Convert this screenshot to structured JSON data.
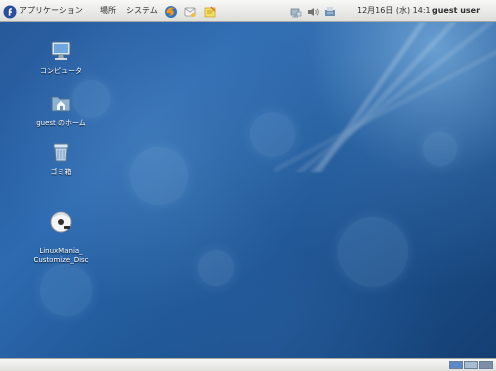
{
  "top_panel": {
    "applications_label": "アプリケーション",
    "places_label": "場所",
    "system_label": "システム",
    "clock": "12月16日 (水) 14:1",
    "user": "guest user",
    "menu_logo_icon": "fedora-logo-icon",
    "launcher_icons": [
      "firefox-icon",
      "evolution-icon",
      "notes-icon"
    ],
    "tray_icons": [
      "network-icon",
      "volume-icon",
      "updates-icon"
    ]
  },
  "desktop": {
    "icons": [
      {
        "label": "コンピュータ",
        "icon": "computer-icon"
      },
      {
        "label": "guest のホーム",
        "icon": "home-folder-icon"
      },
      {
        "label": "ゴミ箱",
        "icon": "trash-icon"
      },
      {
        "label": "LinuxMania_\nCustomize_Disc",
        "icon": "disc-icon"
      }
    ]
  },
  "bottom_panel": {
    "workspace_icons": [
      "workspace-1",
      "workspace-2",
      "workspace-3"
    ]
  },
  "colors": {
    "panel": "#e7e7e4",
    "desktop_blue": "#1f5694",
    "text_dark": "#2e2e2e",
    "text_light": "#ffffff"
  }
}
